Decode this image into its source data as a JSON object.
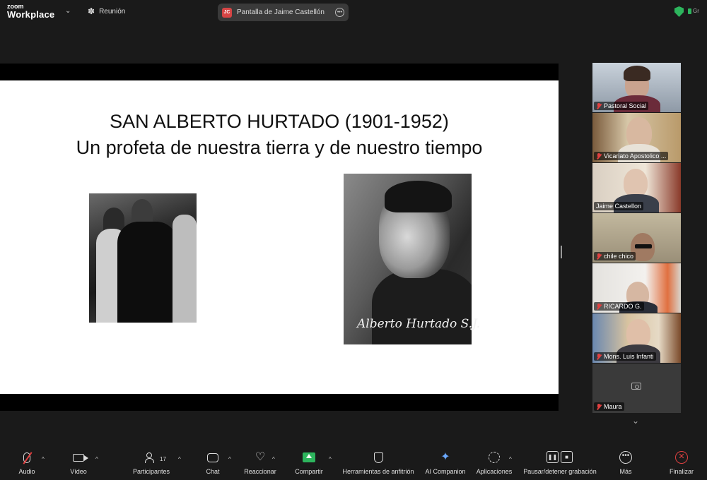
{
  "app": {
    "brand_line1": "zoom",
    "brand_line2": "Workplace"
  },
  "meeting": {
    "label": "Reunión"
  },
  "share_pill": {
    "initials": "JC",
    "text": "Pantalla de Jaime Castellón"
  },
  "top_right": {
    "text": "Gr"
  },
  "slide": {
    "title_line1": "SAN ALBERTO HURTADO (1901-1952)",
    "title_line2": "Un profeta de nuestra tierra y de nuestro tiempo",
    "signature": "Alberto Hurtado S.J."
  },
  "participants": [
    {
      "name": "Pastoral Social",
      "muted": true
    },
    {
      "name": "Vicariato Apostolico ...",
      "muted": true
    },
    {
      "name": "Jaime Castellon",
      "muted": false,
      "active": true
    },
    {
      "name": "chile chico",
      "muted": true
    },
    {
      "name": "RICARDO G.",
      "muted": true
    },
    {
      "name": "Mons. Luis Infanti",
      "muted": true
    },
    {
      "name": "Maura",
      "muted": true,
      "video_off": true
    }
  ],
  "toolbar": {
    "audio": "Audio",
    "video": "Vídeo",
    "participants": "Participantes",
    "participants_count": "17",
    "chat": "Chat",
    "reactions": "Reaccionar",
    "share": "Compartir",
    "host_tools": "Herramientas de anfitrión",
    "ai": "AI Companion",
    "apps": "Aplicaciones",
    "record": "Pausar/detener grabación",
    "more": "Más",
    "end": "Finalizar"
  },
  "colors": {
    "accent_green": "#2db55d",
    "muted_red": "#e04040",
    "active_border": "#3ccf6e"
  }
}
